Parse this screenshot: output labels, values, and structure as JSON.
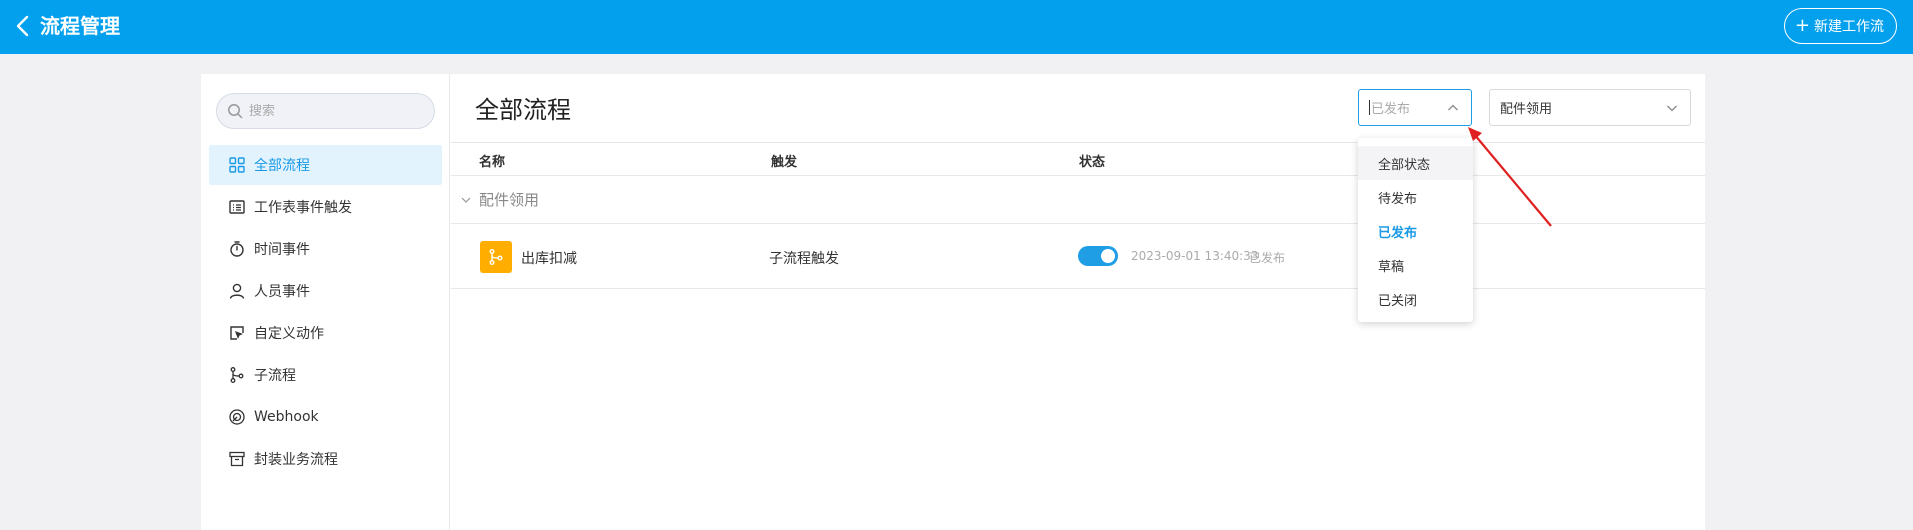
{
  "header": {
    "title": "流程管理",
    "new_button_label": "新建工作流"
  },
  "sidebar": {
    "search_placeholder": "搜索",
    "items": [
      {
        "label": "全部流程",
        "icon": "grid-icon",
        "active": true
      },
      {
        "label": "工作表事件触发",
        "icon": "list-icon"
      },
      {
        "label": "时间事件",
        "icon": "stopwatch-icon"
      },
      {
        "label": "人员事件",
        "icon": "user-icon"
      },
      {
        "label": "自定义动作",
        "icon": "cursor-click-icon"
      },
      {
        "label": "子流程",
        "icon": "branch-icon"
      },
      {
        "label": "Webhook",
        "icon": "webhook-icon"
      },
      {
        "label": "封装业务流程",
        "icon": "archive-box-icon"
      }
    ]
  },
  "main": {
    "title": "全部流程",
    "status_filter": {
      "value": "已发布",
      "options": [
        "全部状态",
        "待发布",
        "已发布",
        "草稿",
        "已关闭"
      ],
      "selected": "已发布"
    },
    "category_filter": {
      "value": "配件领用"
    },
    "columns": {
      "name": "名称",
      "trigger": "触发",
      "status": "状态"
    },
    "group": {
      "name": "配件领用"
    },
    "rows": [
      {
        "name": "出库扣减",
        "trigger": "子流程触发",
        "enabled": true,
        "time": "2023-09-01 13:40:33",
        "status": "已发布"
      }
    ]
  },
  "colors": {
    "brand": "#03a0ee",
    "accent": "#1f9ee6",
    "flow_icon": "#ffae00",
    "annotation_arrow": "#e02020"
  }
}
